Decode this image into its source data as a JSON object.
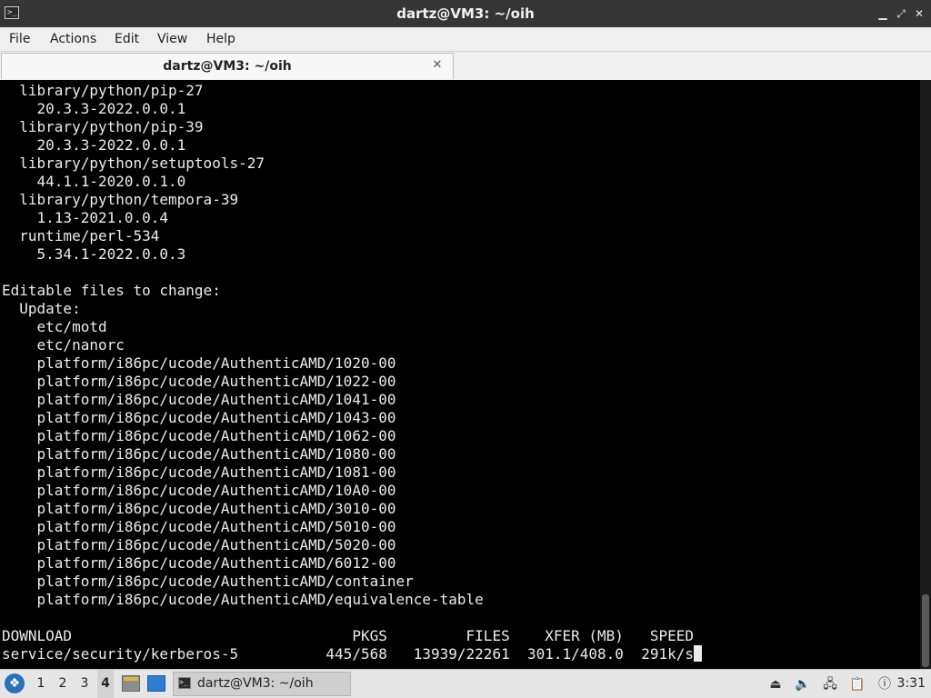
{
  "window": {
    "title": "dartz@VM3: ~/oih",
    "controls": [
      "minimize",
      "maximize",
      "close"
    ]
  },
  "menu": {
    "items": [
      "File",
      "Actions",
      "Edit",
      "View",
      "Help"
    ]
  },
  "tabs": [
    {
      "label": "dartz@VM3: ~/oih",
      "active": true
    }
  ],
  "terminal": {
    "lines": [
      "  library/python/pip-27",
      "    20.3.3-2022.0.0.1",
      "  library/python/pip-39",
      "    20.3.3-2022.0.0.1",
      "  library/python/setuptools-27",
      "    44.1.1-2020.0.1.0",
      "  library/python/tempora-39",
      "    1.13-2021.0.0.4",
      "  runtime/perl-534",
      "    5.34.1-2022.0.0.3",
      "",
      "Editable files to change:",
      "  Update:",
      "    etc/motd",
      "    etc/nanorc",
      "    platform/i86pc/ucode/AuthenticAMD/1020-00",
      "    platform/i86pc/ucode/AuthenticAMD/1022-00",
      "    platform/i86pc/ucode/AuthenticAMD/1041-00",
      "    platform/i86pc/ucode/AuthenticAMD/1043-00",
      "    platform/i86pc/ucode/AuthenticAMD/1062-00",
      "    platform/i86pc/ucode/AuthenticAMD/1080-00",
      "    platform/i86pc/ucode/AuthenticAMD/1081-00",
      "    platform/i86pc/ucode/AuthenticAMD/10A0-00",
      "    platform/i86pc/ucode/AuthenticAMD/3010-00",
      "    platform/i86pc/ucode/AuthenticAMD/5010-00",
      "    platform/i86pc/ucode/AuthenticAMD/5020-00",
      "    platform/i86pc/ucode/AuthenticAMD/6012-00",
      "    platform/i86pc/ucode/AuthenticAMD/container",
      "    platform/i86pc/ucode/AuthenticAMD/equivalence-table",
      "",
      "DOWNLOAD                                PKGS         FILES    XFER (MB)   SPEED",
      "service/security/kerberos-5          445/568   13939/22261  301.1/408.0  291k/s"
    ]
  },
  "taskbar": {
    "workspaces": [
      "1",
      "2",
      "3",
      "4"
    ],
    "active_workspace": "4",
    "task_label": "dartz@VM3: ~/oih",
    "clock": "3:31",
    "tray_icons": [
      "eject-icon",
      "volume-icon",
      "network-icon",
      "clipboard-icon",
      "notification-icon"
    ]
  },
  "colors": {
    "titlebar": "#353535",
    "terminal_bg": "#000000",
    "terminal_fg": "#ececec",
    "taskbar": "#e6e6e6"
  }
}
